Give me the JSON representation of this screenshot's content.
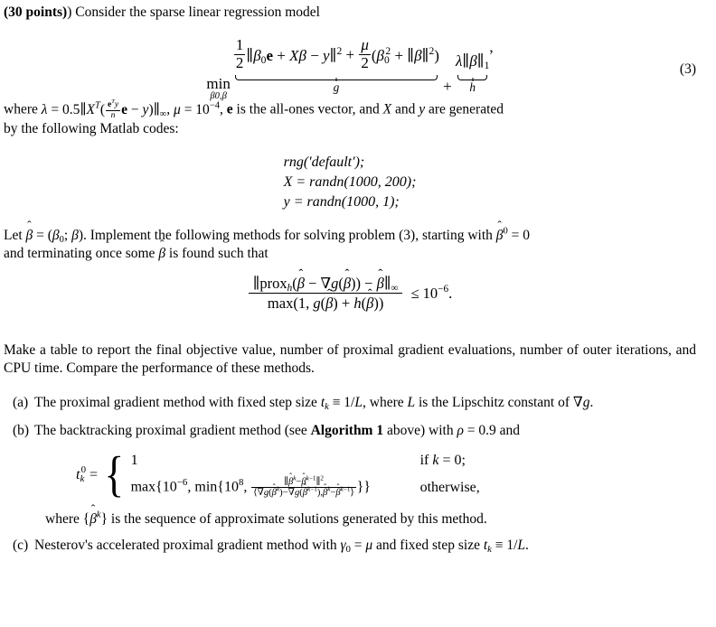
{
  "document": {
    "problem_points_label": "(30 points)",
    "intro_text": "Consider the sparse linear regression model",
    "equation_number": "(3)",
    "equation_3": {
      "operator": "min",
      "operator_subscript": "β0,β",
      "fraction_num": "1",
      "fraction_den": "2",
      "term1": "‖β0e + Xβ − y‖²",
      "plus": "+",
      "mu_frac_num": "μ",
      "mu_frac_den": "2",
      "term2": "(β₀² + ‖β‖²)",
      "term3": "λ‖β‖₁,",
      "underbrace_g": "g",
      "underbrace_h": "h"
    },
    "where_paragraph": {
      "lead": "where",
      "lambda_symbol": "λ",
      "equals": "=",
      "lambda_value": "0.5",
      "norm_open": "‖",
      "X_symbol": "X",
      "transpose": "T",
      "inner_num": "eᵀy",
      "inner_den": "n",
      "inner_rest": "e − y)",
      "norm_sub": "∞",
      "mu_symbol": "μ",
      "mu_value_base": "10",
      "mu_value_exp": "−4",
      "e_desc": "is the all-ones vector, and",
      "X_tail": "X",
      "and_word": "and",
      "y_tail": "y",
      "tail": "are generated",
      "line2": "by the following Matlab codes:"
    },
    "matlab_code": [
      "rng('default');",
      "X = randn(1000, 200);",
      "y = randn(1000, 1);"
    ],
    "let_paragraph": {
      "line_start": "Let",
      "beta_hat": "β̂",
      "equals": "=",
      "tuple": "(β₀; β).",
      "text1": "Implement the following methods for solving problem (3), starting with",
      "beta_hat_0": "β̂⁰",
      "eq_zero": "= 0",
      "line2a": "and terminating once some",
      "line2b": "is found such that"
    },
    "stopping_criterion": {
      "numerator": "‖prox_h(β̂ − ∇g(β̂)) − β̂‖∞",
      "denominator": "max(1, g(β̂) + h(β̂))",
      "relation": "≤",
      "bound_base": "10",
      "bound_exp": "−6",
      "period": "."
    },
    "table_paragraph": "Make a table to report the final objective value, number of proximal gradient evaluations, number of outer iterations, and CPU time. Compare the performance of these methods.",
    "items": [
      {
        "label": "(a)",
        "text_part1": "The proximal gradient method with fixed step size",
        "math1": "tₖ ≡ 1/L,",
        "text_part2": "where",
        "math2": "L",
        "text_part3": "is the Lipschitz constant of",
        "math3": "∇g."
      },
      {
        "label": "(b)",
        "text_part1": "The backtracking proximal gradient method (see",
        "bold_ref": "Algorithm 1",
        "text_part2": "above) with",
        "math1": "ρ = 0.9",
        "text_part3": "and",
        "cases": {
          "lhs": "tₖ⁰",
          "equals": "=",
          "row1_expr": "1",
          "row1_cond": "if k = 0;",
          "row2_prefix": "max{10⁻⁶, min{10⁸,",
          "row2_frac_num": "‖β̂ᵏ−β̂ᵏ⁻¹‖²",
          "row2_frac_den": "⟨∇g(β̂ᵏ)−∇g(β̂ᵏ⁻¹),β̂ᵏ−β̂ᵏ⁻¹⟩",
          "row2_suffix": "}}",
          "row2_cond": "otherwise,"
        },
        "trailing_text": "where {β̂ᵏ} is the sequence of approximate solutions generated by this method."
      },
      {
        "label": "(c)",
        "text_part1": "Nesterov's accelerated proximal gradient method with",
        "math1": "γ₀ = μ",
        "text_part2": "and fixed step size",
        "math2": "tₖ ≡ 1/L."
      }
    ],
    "colors": {
      "text": "#000000",
      "background": "#ffffff"
    }
  }
}
